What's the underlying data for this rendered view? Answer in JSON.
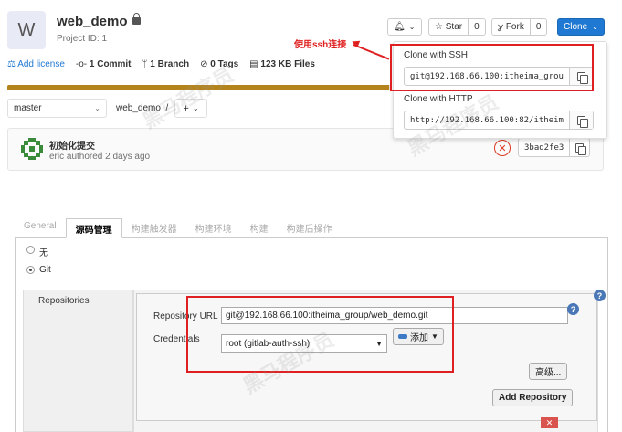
{
  "gitlab": {
    "avatar_letter": "W",
    "project_name": "web_demo",
    "project_id": "Project ID: 1",
    "notification_label": "",
    "star": {
      "label": "Star",
      "count": "0"
    },
    "fork": {
      "label": "Fork",
      "count": "0"
    },
    "clone_button": "Clone",
    "stats": {
      "add_license": "Add license",
      "commits": "1 Commit",
      "branches": "1 Branch",
      "tags": "0 Tags",
      "files": "123 KB Files"
    },
    "progress_fraction": 0.995,
    "branch_select": "master",
    "breadcrumb": "web_demo",
    "breadcrumb_sep": "/",
    "add_button": "+",
    "commit": {
      "title": "初始化提交",
      "meta": "eric authored 2 days ago",
      "sha": "3bad2fe3",
      "status": "failed"
    },
    "clone_dropdown": {
      "ssh_label": "Clone with SSH",
      "ssh_url": "git@192.168.66.100:itheima_grou",
      "http_label": "Clone with HTTP",
      "http_url": "http://192.168.66.100:82/itheim"
    },
    "annotation": "使用ssh连接"
  },
  "jenkins": {
    "tabs": [
      "General",
      "源码管理",
      "构建触发器",
      "构建环境",
      "构建",
      "构建后操作"
    ],
    "scm_options": [
      "无",
      "Git"
    ],
    "selected_scm": "Git",
    "repositories_label": "Repositories",
    "repository_url_label": "Repository URL",
    "repository_url": "git@192.168.66.100:itheima_group/web_demo.git",
    "credentials_label": "Credentials",
    "credentials_value": "root (gitlab-auth-ssh)",
    "add_credentials": "添加",
    "advanced_button": "高级...",
    "add_repository_button": "Add Repository",
    "help_glyph": "?",
    "delete_glyph": "✕"
  },
  "watermark": "黑马程序员",
  "colors": {
    "gitlab_blue": "#1f78d1",
    "progress": "#b5831c",
    "annotation_red": "#e02020",
    "fail_red": "#db3b21"
  }
}
